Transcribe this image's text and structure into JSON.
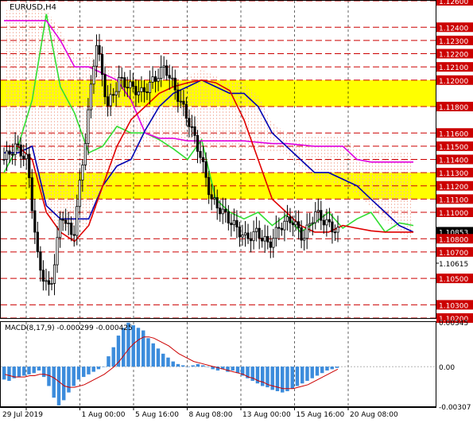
{
  "chart_data": [
    {
      "type": "line",
      "title": "EURUSD,H4",
      "x_ticks": [
        "29 Jul 2019",
        "1 Aug 00:00",
        "5 Aug 16:00",
        "8 Aug 08:00",
        "13 Aug 00:00",
        "15 Aug 16:00",
        "20 Aug 08:00"
      ],
      "ylim": [
        1.102,
        1.126
      ],
      "y_ticks": [
        "1.12600",
        "1.12400",
        "1.12300",
        "1.12200",
        "1.12100",
        "1.12000",
        "1.11800",
        "1.11600",
        "1.11500",
        "1.11400",
        "1.11300",
        "1.11200",
        "1.11100",
        "1.11000",
        "1.10853",
        "1.10800",
        "1.10700",
        "1.10615",
        "1.10500",
        "1.10300",
        "1.10200"
      ],
      "current_price": "1.10853",
      "support_resistance_levels": [
        1.126,
        1.124,
        1.123,
        1.122,
        1.121,
        1.12,
        1.118,
        1.116,
        1.115,
        1.114,
        1.113,
        1.112,
        1.111,
        1.11,
        1.108,
        1.107,
        1.105,
        1.103,
        1.102
      ],
      "zones": [
        {
          "from": 1.118,
          "to": 1.12,
          "color": "#ffff00"
        },
        {
          "from": 1.111,
          "to": 1.113,
          "color": "#ffff00"
        }
      ],
      "grid": true,
      "colors": {
        "candles": "#000000",
        "red_line": "#e00000",
        "blue_line": "#0000b0",
        "green_line": "#33dd33",
        "magenta_line": "#e000e0",
        "levels": "#cc0000",
        "cloud": "#f4b8a8"
      },
      "series": [
        {
          "key": "green",
          "values": [
            1.113,
            1.115,
            1.1185,
            1.125,
            1.1195,
            1.1175,
            1.1145,
            1.115,
            1.1165,
            1.116,
            1.116,
            1.1155,
            1.1148,
            1.114,
            1.1155,
            1.111,
            1.11,
            1.1095,
            1.11,
            1.109,
            1.1098,
            1.1085,
            1.1092,
            1.11,
            1.1088,
            1.1095,
            1.11,
            1.1085,
            1.1092,
            1.109
          ]
        },
        {
          "key": "magenta",
          "values": [
            1.1245,
            1.1245,
            1.1245,
            1.1245,
            1.123,
            1.121,
            1.121,
            1.1205,
            1.12,
            1.1185,
            1.116,
            1.1156,
            1.1156,
            1.1154,
            1.1154,
            1.1154,
            1.1154,
            1.1154,
            1.1153,
            1.1152,
            1.1152,
            1.1151,
            1.115,
            1.115,
            1.115,
            1.114,
            1.1138,
            1.1138,
            1.1138,
            1.1138
          ]
        },
        {
          "key": "blue",
          "values": [
            1.1145,
            1.1145,
            1.115,
            1.1105,
            1.1095,
            1.1095,
            1.1095,
            1.112,
            1.1135,
            1.114,
            1.1162,
            1.118,
            1.119,
            1.1195,
            1.12,
            1.1195,
            1.119,
            1.119,
            1.118,
            1.116,
            1.115,
            1.114,
            1.113,
            1.113,
            1.1125,
            1.112,
            1.111,
            1.11,
            1.109,
            1.1085
          ]
        },
        {
          "key": "red",
          "values": [
            1.115,
            1.115,
            1.114,
            1.11,
            1.1085,
            1.1078,
            1.109,
            1.112,
            1.115,
            1.117,
            1.118,
            1.119,
            1.1195,
            1.1198,
            1.12,
            1.1198,
            1.1192,
            1.117,
            1.114,
            1.111,
            1.11,
            1.109,
            1.1085,
            1.1085,
            1.109,
            1.1088,
            1.1086,
            1.1085,
            1.1085,
            1.1085
          ]
        },
        {
          "key": "price",
          "values": [
            1.114,
            1.115,
            1.114,
            1.106,
            1.104,
            1.11,
            1.108,
            1.115,
            1.123,
            1.118,
            1.12,
            1.1195,
            1.119,
            1.12,
            1.121,
            1.119,
            1.117,
            1.1145,
            1.111,
            1.11,
            1.109,
            1.108,
            1.1085,
            1.1075,
            1.109,
            1.1095,
            1.108,
            1.11,
            1.1092,
            1.1085
          ]
        }
      ]
    },
    {
      "type": "bar",
      "title": "MACD(8,17,9) -0.000299 -0.000425",
      "ylim": [
        -0.00307,
        0.00345
      ],
      "y_ticks": [
        "0.00345",
        "0.00",
        "-0.00307"
      ],
      "histogram": [
        -0.001,
        -0.0011,
        -0.0009,
        -0.0008,
        -0.0007,
        -0.0006,
        -0.0005,
        -0.0003,
        -0.0008,
        -0.0015,
        -0.0024,
        -0.003,
        -0.0026,
        -0.002,
        -0.0015,
        -0.001,
        -0.0008,
        -0.0006,
        -0.0004,
        -0.0002,
        0.0,
        0.0008,
        0.0015,
        0.0024,
        0.003,
        0.0034,
        0.0032,
        0.003,
        0.0028,
        0.0022,
        0.0018,
        0.0014,
        0.001,
        0.0007,
        0.0004,
        0.0002,
        0.0001,
        0.0,
        0.0001,
        0.0002,
        0.0001,
        0.0,
        -0.0002,
        -0.0003,
        -0.0002,
        -0.0004,
        -0.0003,
        -0.0005,
        -0.0007,
        -0.0009,
        -0.0011,
        -0.0013,
        -0.0015,
        -0.0016,
        -0.0018,
        -0.0019,
        -0.002,
        -0.0019,
        -0.0017,
        -0.0015,
        -0.0013,
        -0.0011,
        -0.0009,
        -0.0007,
        -0.0005,
        -0.0003,
        -0.0002,
        -0.0001
      ],
      "signal": [
        -0.0006,
        -0.0007,
        -0.0008,
        -0.0008,
        -0.0008,
        -0.0007,
        -0.0007,
        -0.0006,
        -0.0006,
        -0.0007,
        -0.0009,
        -0.0012,
        -0.0015,
        -0.0016,
        -0.0016,
        -0.0015,
        -0.0014,
        -0.0012,
        -0.001,
        -0.0008,
        -0.0006,
        -0.0003,
        0.0,
        0.0004,
        0.0009,
        0.0014,
        0.0018,
        0.0021,
        0.0023,
        0.0023,
        0.0022,
        0.002,
        0.0018,
        0.0016,
        0.0013,
        0.001,
        0.0008,
        0.0006,
        0.0004,
        0.0003,
        0.0002,
        0.0001,
        0.0,
        -0.0001,
        -0.0002,
        -0.0003,
        -0.0004,
        -0.0005,
        -0.0006,
        -0.0008,
        -0.0009,
        -0.0011,
        -0.0012,
        -0.0014,
        -0.0015,
        -0.0016,
        -0.0017,
        -0.0017,
        -0.0017,
        -0.0016,
        -0.0015,
        -0.0014,
        -0.0012,
        -0.001,
        -0.0008,
        -0.0006,
        -0.0004,
        -0.0002
      ]
    }
  ]
}
